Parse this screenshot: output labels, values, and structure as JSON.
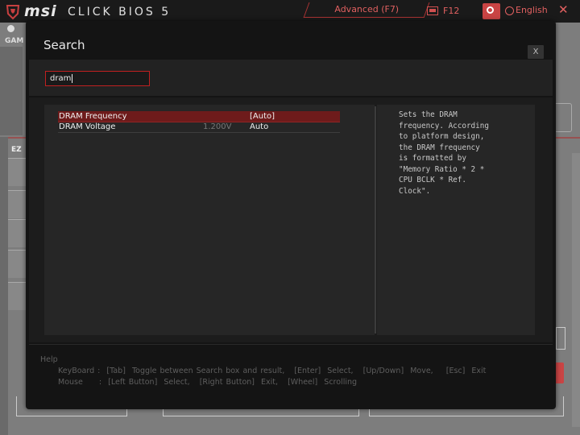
{
  "background": {
    "brand": "msi",
    "bios_title": "CLICK BIOS 5",
    "mode_button": "Advanced (F7)",
    "screenshot_label": "F12",
    "language_label": "English",
    "close_glyph": "✕",
    "game_label": "GAM",
    "ez_label": "EZ",
    "accent_color": "#e06060"
  },
  "dialog": {
    "title": "Search",
    "close_label": "X",
    "search": {
      "value": "dram"
    },
    "results": [
      {
        "name": "DRAM Frequency",
        "current": "",
        "value": "[Auto]",
        "selected": true
      },
      {
        "name": "DRAM Voltage",
        "current": "1.200V",
        "value": "Auto",
        "selected": false
      }
    ],
    "help_description": "Sets the DRAM\nfrequency. According\nto platform design,\nthe DRAM frequency\nis formatted by\n\"Memory Ratio * 2 *\nCPU BCLK * Ref.\nClock\".",
    "help_section": {
      "title": "Help",
      "keyboard": "KeyBoard :  [Tab]  Toggle between Search box and result,   [Enter]  Select,   [Up/Down]  Move,    [Esc]  Exit",
      "mouse": "Mouse     :  [Left Button]  Select,   [Right Button]  Exit,   [Wheel]  Scrolling"
    }
  },
  "colors": {
    "selection": "#6e1b1b",
    "input_border": "#c02020",
    "dialog_bg": "#141414"
  }
}
